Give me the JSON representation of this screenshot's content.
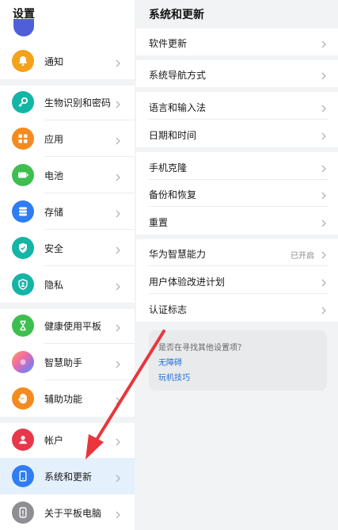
{
  "left": {
    "title": "设置",
    "items": [
      {
        "label": "通知",
        "icon": "bell-icon",
        "color": "#f4a11b"
      },
      {
        "label": "生物识别和密码",
        "icon": "key-icon",
        "color": "#14b5a6"
      },
      {
        "label": "应用",
        "icon": "apps-grid-icon",
        "color": "#f58a1f"
      },
      {
        "label": "电池",
        "icon": "battery-icon",
        "color": "#3cbf4e"
      },
      {
        "label": "存储",
        "icon": "storage-icon",
        "color": "#2f7df2"
      },
      {
        "label": "安全",
        "icon": "shield-check-icon",
        "color": "#14b5a6"
      },
      {
        "label": "隐私",
        "icon": "privacy-icon",
        "color": "#14b5a6"
      },
      {
        "label": "健康使用平板",
        "icon": "hourglass-icon",
        "color": "#3cbf4e"
      },
      {
        "label": "智慧助手",
        "icon": "smart-assistant-icon",
        "color": "#b67ad6"
      },
      {
        "label": "辅助功能",
        "icon": "hand-icon",
        "color": "#f58a1f"
      },
      {
        "label": "帐户",
        "icon": "account-icon",
        "color": "#e8364a"
      },
      {
        "label": "系统和更新",
        "icon": "system-update-icon",
        "color": "#2f7df2",
        "selected": true
      },
      {
        "label": "关于平板电脑",
        "icon": "tablet-info-icon",
        "color": "#8e8e93"
      }
    ]
  },
  "right": {
    "title": "系统和更新",
    "groups": [
      [
        {
          "label": "软件更新"
        }
      ],
      [
        {
          "label": "系统导航方式"
        }
      ],
      [
        {
          "label": "语言和输入法"
        },
        {
          "label": "日期和时间"
        }
      ],
      [
        {
          "label": "手机克隆"
        },
        {
          "label": "备份和恢复"
        },
        {
          "label": "重置"
        }
      ],
      [
        {
          "label": "华为智慧能力",
          "value": "已开启"
        },
        {
          "label": "用户体验改进计划"
        },
        {
          "label": "认证标志"
        }
      ]
    ],
    "suggestion": {
      "title": "是否在寻找其他设置项？",
      "links": [
        "无障碍",
        "玩机技巧"
      ]
    }
  },
  "annotation": {
    "arrow_color": "#e8363c"
  }
}
